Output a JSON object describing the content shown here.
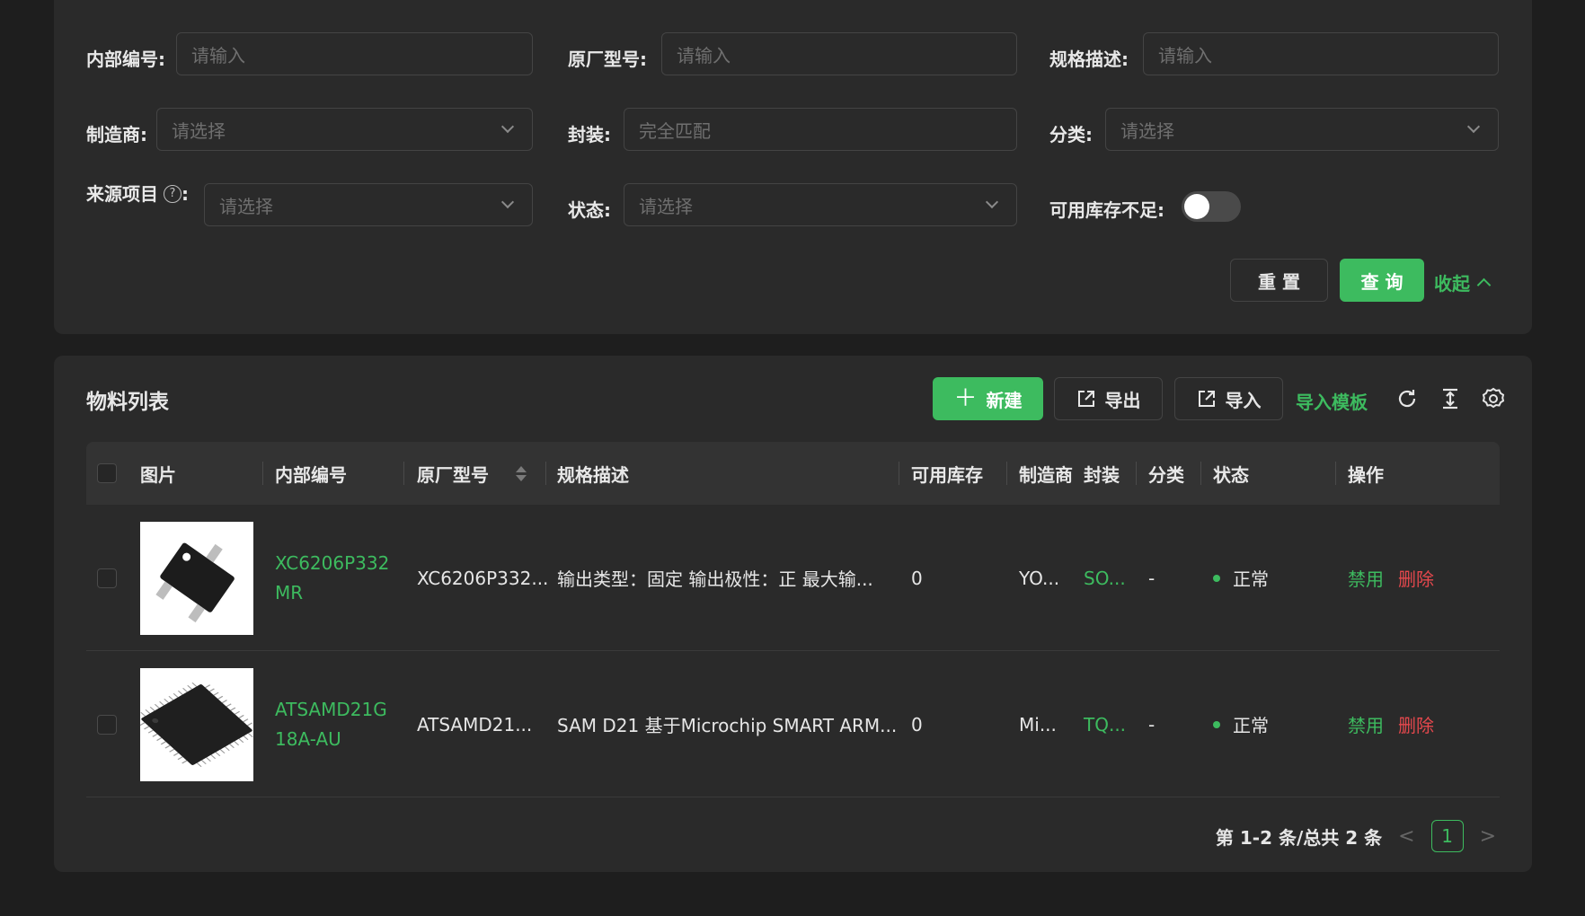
{
  "filters": {
    "internal_no": {
      "label": "内部编号",
      "placeholder": "请输入"
    },
    "mfr_model": {
      "label": "原厂型号",
      "placeholder": "请输入"
    },
    "spec": {
      "label": "规格描述",
      "placeholder": "请输入"
    },
    "manufacturer": {
      "label": "制造商",
      "placeholder": "请选择"
    },
    "package": {
      "label": "封装",
      "placeholder": "完全匹配"
    },
    "category": {
      "label": "分类",
      "placeholder": "请选择"
    },
    "source_project": {
      "label": "来源项目",
      "placeholder": "请选择",
      "help": "?"
    },
    "status": {
      "label": "状态",
      "placeholder": "请选择"
    },
    "low_stock": {
      "label": "可用库存不足",
      "on": false
    },
    "colon": ":",
    "reset_label": "重 置",
    "query_label": "查 询",
    "collapse_label": "收起"
  },
  "list": {
    "title": "物料列表",
    "new_label": "新建",
    "export_label": "导出",
    "import_label": "导入",
    "template_label": "导入模板",
    "columns": [
      "图片",
      "内部编号",
      "原厂型号",
      "规格描述",
      "可用库存",
      "制造商",
      "封装",
      "分类",
      "状态",
      "操作"
    ],
    "rows": [
      {
        "internal_no": "XC6206P332MR",
        "mfr_model": "XC6206P332...",
        "spec": "输出类型：固定 输出极性：正 最大输...",
        "stock": "0",
        "manufacturer": "YO...",
        "package": "SO...",
        "category": "-",
        "status": "正常",
        "action_disable": "禁用",
        "action_delete": "删除",
        "image": "sot23-chip"
      },
      {
        "internal_no": "ATSAMD21G18A-AU",
        "mfr_model": "ATSAMD21...",
        "spec": "SAM D21 基于Microchip SMART ARM...",
        "stock": "0",
        "manufacturer": "Mi...",
        "package": "TQ...",
        "category": "-",
        "status": "正常",
        "action_disable": "禁用",
        "action_delete": "删除",
        "image": "tqfp-chip"
      }
    ],
    "pagination": {
      "summary": "第 1-2 条/总共 2 条",
      "current_page": "1",
      "prev": "<",
      "next": ">"
    }
  },
  "colors": {
    "accent": "#3dbb5f",
    "danger": "#e5484d",
    "panel": "#2a2a2a",
    "background": "#1e1e1e"
  }
}
